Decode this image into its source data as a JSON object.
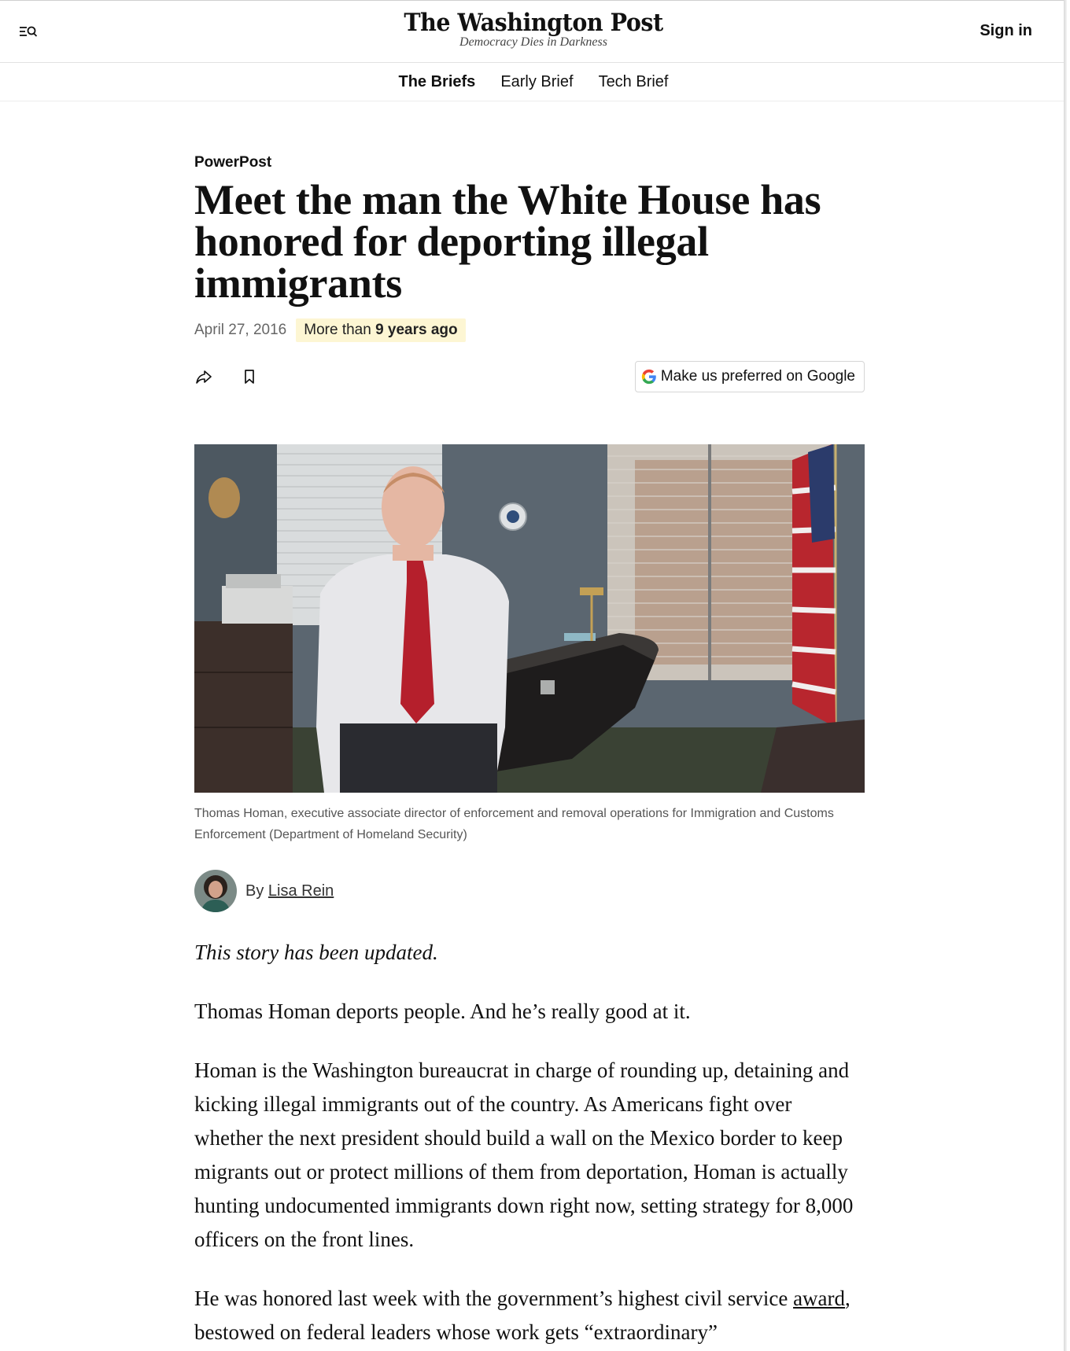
{
  "header": {
    "logo": "The Washington Post",
    "tagline": "Democracy Dies in Darkness",
    "sign_in": "Sign in"
  },
  "subnav": {
    "items": [
      {
        "label": "The Briefs"
      },
      {
        "label": "Early Brief"
      },
      {
        "label": "Tech Brief"
      }
    ]
  },
  "article": {
    "kicker": "PowerPost",
    "headline": "Meet the man the White House has honored for deporting illegal immigrants",
    "date": "April 27, 2016",
    "age_prefix": "More than",
    "age_bold": "9 years ago",
    "google_button": "Make us preferred on Google",
    "caption": "Thomas Homan, executive associate director of enforcement and removal operations for Immigration and Customs Enforcement (Department of Homeland Security)",
    "byline_prefix": "By",
    "author": "Lisa Rein",
    "update_note": "This story has been updated.",
    "paragraphs": [
      "Thomas Homan deports people. And he’s really good at it.",
      "Homan is the Washington bureaucrat in charge of rounding up, detaining and kicking illegal immigrants out of the country. As Americans fight over whether the next president should build a wall on the Mexico border to keep migrants out or protect millions of them from deportation, Homan is actually hunting undocumented immigrants down right now, setting strategy for 8,000 officers on the front lines."
    ],
    "para3_before": "He was honored last week with the government’s highest civil service",
    "para3_link": "award",
    "para3_after": ", bestowed on federal leaders whose work gets “extraordinary”"
  }
}
